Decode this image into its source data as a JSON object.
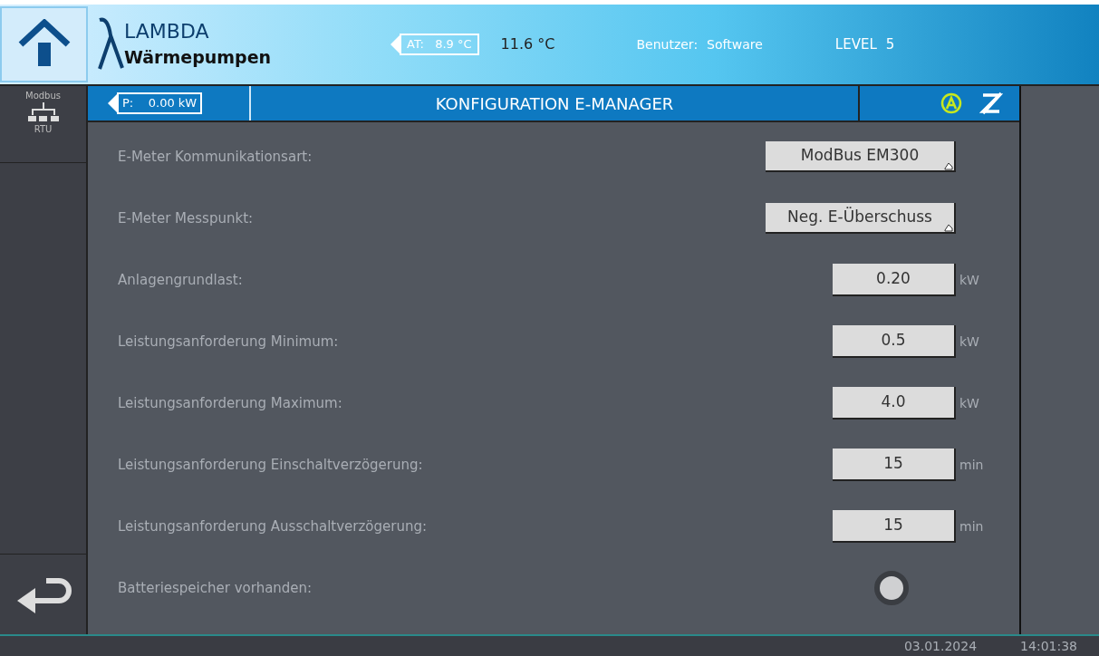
{
  "header": {
    "logo_top": "LAMBDA",
    "logo_bottom": "Wärmepumpen",
    "outdoor_temp": "AT:   8.9 °C",
    "temp": "11.6 °C",
    "user_label": "Benutzer:",
    "user": "Software",
    "level_label": "LEVEL",
    "level": "5"
  },
  "sidebar": {
    "top_label": "Modbus",
    "bottom_label": "RTU"
  },
  "title_bar": {
    "power": "P:    0.00 kW",
    "title": "KONFIGURATION E-MANAGER"
  },
  "rows": [
    {
      "kind": "dropdown",
      "label": "E-Meter Kommunikationsart:",
      "value": "ModBus EM300"
    },
    {
      "kind": "dropdown",
      "label": "E-Meter Messpunkt:",
      "value": "Neg. E-Überschuss"
    },
    {
      "kind": "number",
      "label": "Anlagengrundlast:",
      "value": "0.20",
      "unit": "kW"
    },
    {
      "kind": "number",
      "label": "Leistungsanforderung Minimum:",
      "value": "0.5",
      "unit": "kW"
    },
    {
      "kind": "number",
      "label": "Leistungsanforderung Maximum:",
      "value": "4.0",
      "unit": "kW"
    },
    {
      "kind": "number",
      "label": "Leistungsanforderung Einschaltverzögerung:",
      "value": "15",
      "unit": "min"
    },
    {
      "kind": "number",
      "label": "Leistungsanforderung Ausschaltverzögerung:",
      "value": "15",
      "unit": "min"
    },
    {
      "kind": "toggle",
      "label": "Batteriespeicher vorhanden:",
      "on": false
    }
  ],
  "status_bar": {
    "date": "03.01.2024",
    "time": "14:01:38"
  }
}
